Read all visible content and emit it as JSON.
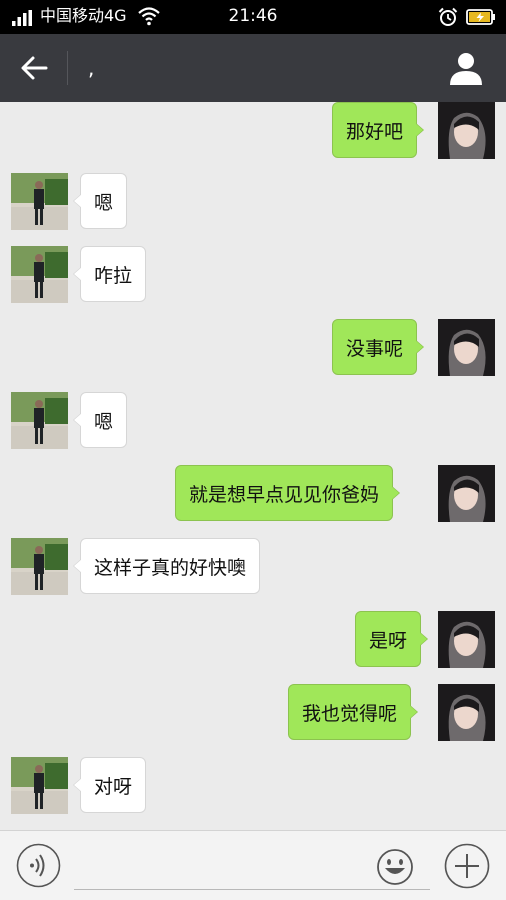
{
  "status_bar": {
    "carrier": "中国移动4G",
    "time": "21:46"
  },
  "header": {
    "title": ","
  },
  "colors": {
    "header_bg": "#393a3f",
    "chat_bg": "#ebebeb",
    "outgoing_bubble": "#a0e759",
    "incoming_bubble": "#ffffff"
  },
  "messages": [
    {
      "side": "right",
      "text": "那好吧"
    },
    {
      "side": "left",
      "text": "嗯"
    },
    {
      "side": "left",
      "text": "咋拉"
    },
    {
      "side": "right",
      "text": "没事呢"
    },
    {
      "side": "left",
      "text": "嗯"
    },
    {
      "side": "right",
      "text": "就是想早点见见你爸妈"
    },
    {
      "side": "left",
      "text": "这样子真的好快噢"
    },
    {
      "side": "right",
      "text": "是呀"
    },
    {
      "side": "right",
      "text": "我也觉得呢"
    },
    {
      "side": "left",
      "text": "对呀"
    }
  ],
  "input_bar": {
    "placeholder": "",
    "icons": [
      "voice-icon",
      "emoji-icon",
      "plus-icon"
    ]
  }
}
